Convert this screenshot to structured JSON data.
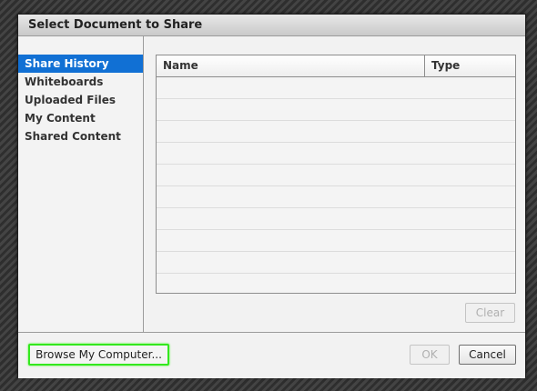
{
  "dialog": {
    "title": "Select Document to Share"
  },
  "sidebar": {
    "items": [
      {
        "label": "Share History",
        "selected": true
      },
      {
        "label": "Whiteboards",
        "selected": false
      },
      {
        "label": "Uploaded Files",
        "selected": false
      },
      {
        "label": "My Content",
        "selected": false
      },
      {
        "label": "Shared Content",
        "selected": false
      }
    ]
  },
  "table": {
    "columns": [
      "Name",
      "Type"
    ],
    "rows": []
  },
  "buttons": {
    "clear": "Clear",
    "browse": "Browse My Computer...",
    "ok": "OK",
    "cancel": "Cancel"
  },
  "colors": {
    "selection": "#1170d4",
    "focus_ring": "#34e81f"
  }
}
